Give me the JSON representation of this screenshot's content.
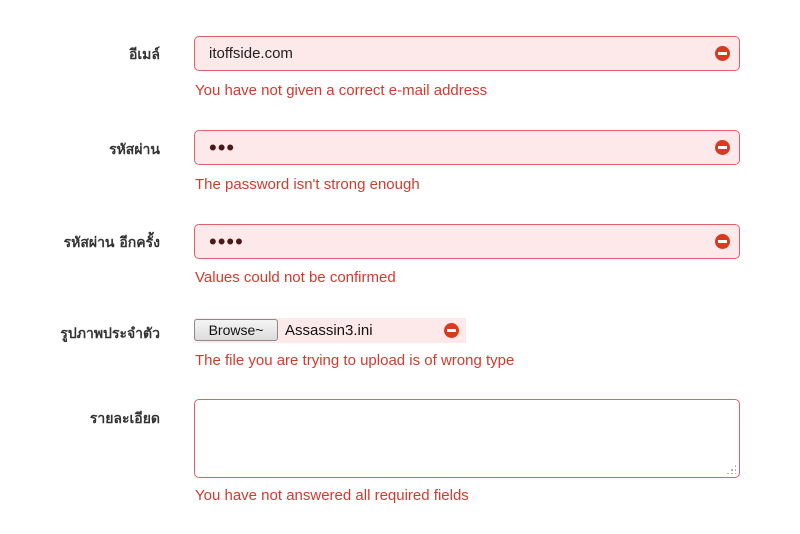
{
  "form": {
    "email": {
      "label": "อีเมล์",
      "value": "itoffside.com",
      "error": "You have not given a correct e-mail address"
    },
    "password": {
      "label": "รหัสผ่าน",
      "value": "•••",
      "error": "The password isn't strong enough"
    },
    "password_confirm": {
      "label": "รหัสผ่าน อีกครั้ง",
      "value": "••••",
      "error": "Values could not be confirmed"
    },
    "avatar": {
      "label": "รูปภาพประจำตัว",
      "browse_label": "Browse~",
      "file_name": "Assassin3.ini",
      "error": "The file you are trying to upload is of wrong type"
    },
    "details": {
      "label": "รายละเอียด",
      "value": "",
      "error": "You have not answered all required fields"
    }
  },
  "colors": {
    "error_text": "#d23a2e",
    "field_border": "#e0606a",
    "field_background": "#fde9ea",
    "error_icon": "#d8391f"
  },
  "icons": [
    "error-icon",
    "resize-grip-icon"
  ]
}
